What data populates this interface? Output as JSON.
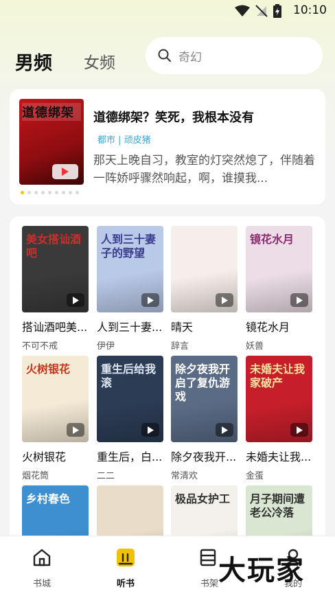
{
  "status": {
    "time": "10:10"
  },
  "header": {
    "tab_male": "男频",
    "tab_female": "女频",
    "search_placeholder": "奇幻"
  },
  "banner": {
    "cover_text": "道德绑架",
    "title": "道德绑架？笑死，我根本没有",
    "meta": "都市 | 顽皮猪",
    "desc": "那天上晚自习，教室的灯突然熄了，伴随着一阵娇呼骤然响起，啊，谁摸我...",
    "dots_count": 9,
    "active_dot": 0
  },
  "books": [
    {
      "title": "搭讪酒吧美...",
      "author": "不可不戒",
      "cover_text": "美女搭讪酒吧",
      "cover_color": "#3a3a3a",
      "label_color": "#c9302c"
    },
    {
      "title": "人到三十妻...",
      "author": "伊伊",
      "cover_text": "人到三十妻子的野望",
      "cover_color": "#b9c9e8",
      "label_color": "#3b3b8f"
    },
    {
      "title": "晴天",
      "author": "辞言",
      "cover_text": "",
      "cover_color": "#f6eeea",
      "label_color": "#c0262b"
    },
    {
      "title": "镜花水月",
      "author": "妖兽",
      "cover_text": "镜花水月",
      "cover_color": "#ecdde6",
      "label_color": "#8a2d6f"
    },
    {
      "title": "火树银花",
      "author": "烟花筒",
      "cover_text": "火树银花",
      "cover_color": "#f5ead6",
      "label_color": "#c8341c"
    },
    {
      "title": "重生后，白...",
      "author": "二二",
      "cover_text": "重生后给我滚",
      "cover_color": "#2c3c55",
      "label_color": "#dfe7f2"
    },
    {
      "title": "除夕夜我开...",
      "author": "常清欢",
      "cover_text": "除夕夜我开启了复仇游戏",
      "cover_color": "#5a6b86",
      "label_color": "#ffffff"
    },
    {
      "title": "未婚夫让我...",
      "author": "金蛋",
      "cover_text": "未婚夫让我家破产",
      "cover_color": "#c61f2a",
      "label_color": "#f7e3a0"
    },
    {
      "title": "",
      "author": "",
      "cover_text": "乡村春色",
      "cover_color": "#3d8fd0",
      "label_color": "#ffffff"
    },
    {
      "title": "",
      "author": "",
      "cover_text": "",
      "cover_color": "#e9dcc8",
      "label_color": "#6b4a2a"
    },
    {
      "title": "",
      "author": "",
      "cover_text": "极品女护工",
      "cover_color": "#f4f1ec",
      "label_color": "#333333"
    },
    {
      "title": "",
      "author": "",
      "cover_text": "月子期间遭老公冷落",
      "cover_color": "#d9e6d2",
      "label_color": "#333333"
    }
  ],
  "nav": [
    {
      "label": "书城",
      "icon": "home-icon"
    },
    {
      "label": "听书",
      "icon": "audio-icon"
    },
    {
      "label": "书架",
      "icon": "shelf-icon"
    },
    {
      "label": "我的",
      "icon": "profile-icon"
    }
  ],
  "nav_active": 1,
  "watermark": "大玩家"
}
